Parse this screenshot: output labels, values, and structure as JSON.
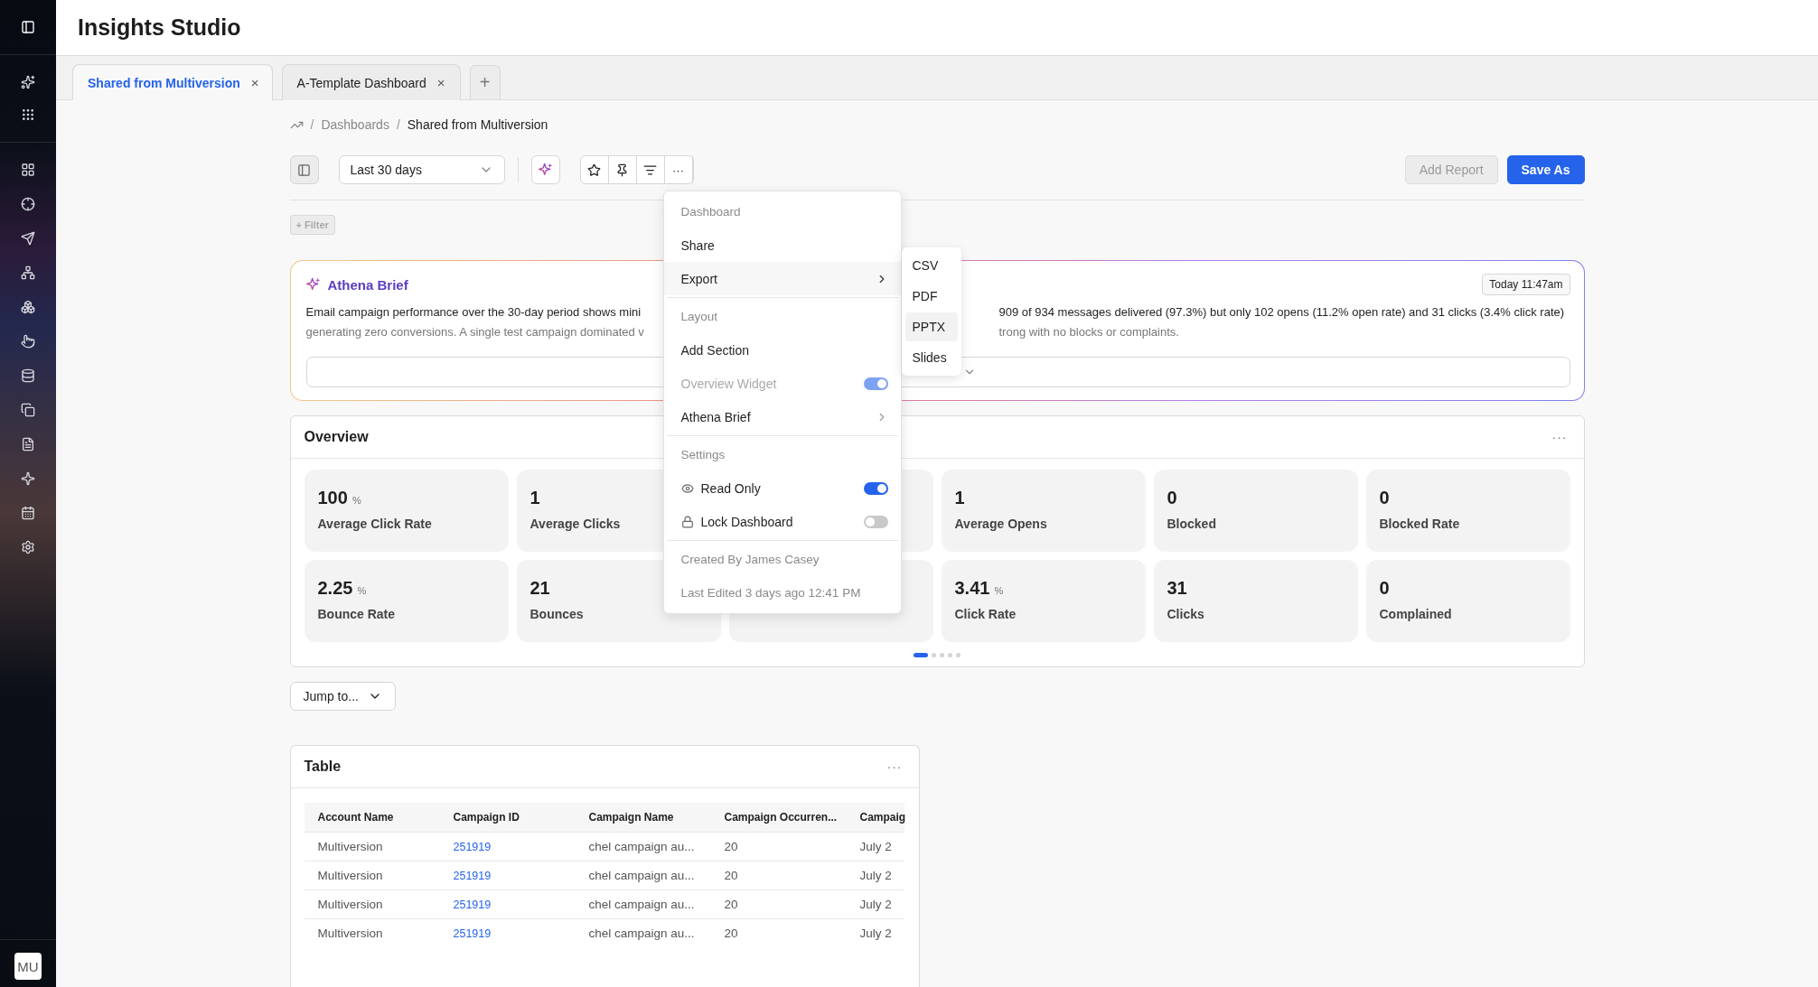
{
  "app": {
    "title": "Insights Studio",
    "avatar": "MU"
  },
  "tabs": [
    {
      "label": "Shared from Multiversion",
      "selected": true,
      "close": "×"
    },
    {
      "label": "A-Template Dashboard",
      "selected": false,
      "close": "×"
    }
  ],
  "new_tab": "+",
  "breadcrumb": [
    {
      "sep": "/",
      "label": "Dashboards"
    },
    {
      "sep": "/",
      "label": "Shared from Multiversion"
    }
  ],
  "toolbar": {
    "date_range": "Last 30 days",
    "more": "···",
    "add_report": {
      "label": "Add Report",
      "disabled": true
    },
    "save_as": {
      "label": "Save As",
      "disabled": false
    }
  },
  "filter": {
    "label": "+ Filter",
    "disabled": true
  },
  "brief": {
    "title": "Athena Brief",
    "timestamp": "Today 11:47am",
    "lines": [
      {
        "left": "Email campaign performance over the 30-day period shows mini",
        "right": "909 of 934 messages delivered (97.3%) but only 102 opens (11.2% open rate) and 31 clicks (3.4% click rate)"
      },
      {
        "left": "generating zero conversions. A single test campaign dominated v",
        "right": "trong with no blocks or complaints."
      }
    ]
  },
  "menu": {
    "items": [
      {
        "kind": "header",
        "label": "Dashboard"
      },
      {
        "kind": "item",
        "label": "Share"
      },
      {
        "kind": "submenu",
        "label": "Export",
        "expanded": true,
        "children": [
          {
            "label": "CSV",
            "selected": false
          },
          {
            "label": "PDF",
            "selected": false
          },
          {
            "label": "PPTX",
            "selected": true
          },
          {
            "label": "Slides",
            "selected": false
          }
        ]
      },
      {
        "kind": "divider"
      },
      {
        "kind": "header",
        "label": "Layout"
      },
      {
        "kind": "item",
        "label": "Add Section"
      },
      {
        "kind": "toggle",
        "label": "Overview Widget",
        "on": true,
        "disabled": true
      },
      {
        "kind": "submenu",
        "label": "Athena Brief",
        "expanded": false
      },
      {
        "kind": "divider"
      },
      {
        "kind": "header",
        "label": "Settings"
      },
      {
        "kind": "option",
        "label": "Read Only",
        "on": true,
        "disabled": false
      },
      {
        "kind": "option",
        "label": "Lock Dashboard",
        "on": false,
        "disabled": false
      },
      {
        "kind": "divider"
      },
      {
        "kind": "info",
        "label": "Created By James Casey"
      },
      {
        "kind": "info",
        "label": "Last Edited 3 days ago 12:41 PM"
      }
    ]
  },
  "overview": {
    "title": "Overview",
    "more": "···",
    "metrics": [
      {
        "kind": "metric",
        "value": "100",
        "unit": "%",
        "label": "Average Click Rate"
      },
      {
        "kind": "metric",
        "value": "1",
        "label": "Average Clicks"
      },
      {
        "kind": "covered"
      },
      {
        "kind": "metric",
        "value": "1",
        "label": "Average Opens"
      },
      {
        "kind": "metric",
        "value": "0",
        "label": "Blocked"
      },
      {
        "kind": "metric",
        "value": "0",
        "label": "Blocked Rate"
      },
      {
        "kind": "metric",
        "value": "2.25",
        "unit": "%",
        "label": "Bounce Rate"
      },
      {
        "kind": "metric",
        "value": "21",
        "label": "Bounces"
      },
      {
        "kind": "covered"
      },
      {
        "kind": "metric",
        "value": "3.41",
        "unit": "%",
        "label": "Click Rate"
      },
      {
        "kind": "metric",
        "value": "31",
        "label": "Clicks"
      },
      {
        "kind": "metric",
        "value": "0",
        "label": "Complained"
      }
    ],
    "pages": [
      {
        "selected": true
      },
      {
        "selected": false
      },
      {
        "selected": false
      },
      {
        "selected": false
      },
      {
        "selected": false
      }
    ]
  },
  "jump": "Jump to...",
  "table": {
    "title": "Table",
    "more": "···",
    "columns": [
      "Account Name",
      "Campaign ID",
      "Campaign Name",
      "Campaign Occurren...",
      "Campaig"
    ],
    "rows": [
      [
        "Multiversion",
        "251919",
        "chel campaign au...",
        "20",
        "July 2"
      ],
      [
        "Multiversion",
        "251919",
        "chel campaign au...",
        "20",
        "July 2"
      ],
      [
        "Multiversion",
        "251919",
        "chel campaign au...",
        "20",
        "July 2"
      ],
      [
        "Multiversion",
        "251919",
        "chel campaign au...",
        "20",
        "July 2"
      ]
    ]
  }
}
